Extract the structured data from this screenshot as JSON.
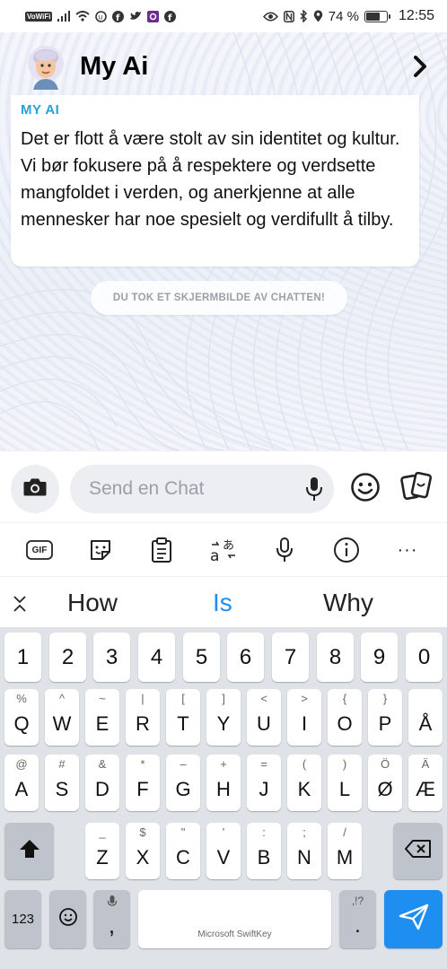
{
  "status_bar": {
    "vowifi": "VoWiFi",
    "battery_percent": "74 %",
    "battery_level": 0.74,
    "time": "12:55"
  },
  "header": {
    "title": "My Ai"
  },
  "message": {
    "sender": "MY AI",
    "text": "Det er flott å være stolt av sin identitet og kultur. Vi bør fokusere på å respektere og verdsette mangfoldet i verden, og anerkjenne at alle mennesker har noe spesielt og verdifullt å tilby."
  },
  "notice": "DU TOK ET SKJERMBILDE AV CHATTEN!",
  "input": {
    "placeholder": "Send en Chat"
  },
  "toolbar": {
    "gif_label": "GIF",
    "more_label": "···"
  },
  "suggestions": [
    "How",
    "Is",
    "Why"
  ],
  "colors": {
    "accent_blue": "#2aa0d8",
    "send_key": "#1e8ef0"
  },
  "keyboard": {
    "number_row": [
      "1",
      "2",
      "3",
      "4",
      "5",
      "6",
      "7",
      "8",
      "9",
      "0"
    ],
    "row1": [
      {
        "main": "Q",
        "alt": "%"
      },
      {
        "main": "W",
        "alt": "^"
      },
      {
        "main": "E",
        "alt": "~"
      },
      {
        "main": "R",
        "alt": "|"
      },
      {
        "main": "T",
        "alt": "["
      },
      {
        "main": "Y",
        "alt": "]"
      },
      {
        "main": "U",
        "alt": "<"
      },
      {
        "main": "I",
        "alt": ">"
      },
      {
        "main": "O",
        "alt": "{"
      },
      {
        "main": "P",
        "alt": "}"
      },
      {
        "main": "Å",
        "alt": ""
      }
    ],
    "row2": [
      {
        "main": "A",
        "alt": "@"
      },
      {
        "main": "S",
        "alt": "#"
      },
      {
        "main": "D",
        "alt": "&"
      },
      {
        "main": "F",
        "alt": "*"
      },
      {
        "main": "G",
        "alt": "–"
      },
      {
        "main": "H",
        "alt": "+"
      },
      {
        "main": "J",
        "alt": "="
      },
      {
        "main": "K",
        "alt": "("
      },
      {
        "main": "L",
        "alt": ")"
      },
      {
        "main": "Ø",
        "alt": "Ö"
      },
      {
        "main": "Æ",
        "alt": "Ä"
      }
    ],
    "row3": [
      {
        "main": "Z",
        "alt": "_"
      },
      {
        "main": "X",
        "alt": "$"
      },
      {
        "main": "C",
        "alt": "\""
      },
      {
        "main": "V",
        "alt": "'"
      },
      {
        "main": "B",
        "alt": ":"
      },
      {
        "main": "N",
        "alt": ";"
      },
      {
        "main": "M",
        "alt": "/"
      }
    ],
    "numbers_key": "123",
    "comma_key": ",",
    "period_key": ".",
    "period_alt": ",!?",
    "space_label": "Microsoft SwiftKey"
  }
}
